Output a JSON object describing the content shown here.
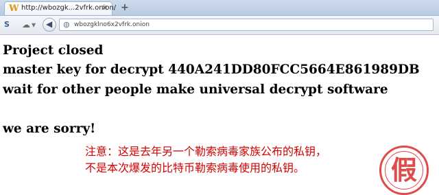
{
  "browser": {
    "tab": {
      "title": "http://wbozgk...2vfrk.onion/"
    },
    "address_bar": {
      "url": "wbozgklno6x2vfrk.onion"
    }
  },
  "page": {
    "lines": [
      "Project closed",
      "master key for decrypt 440A241DD80FCC5664E861989DB",
      "wait for other people make universal decrypt software",
      "we are sorry!"
    ],
    "note": {
      "line1": "注意：这是去年另一个勒索病毒家族公布的私钥，",
      "line2": "不是本次爆发的比特币勒索病毒使用的私钥。",
      "color": "#d40000"
    },
    "stamp": {
      "text": "假",
      "color": "#e04a4a"
    }
  }
}
